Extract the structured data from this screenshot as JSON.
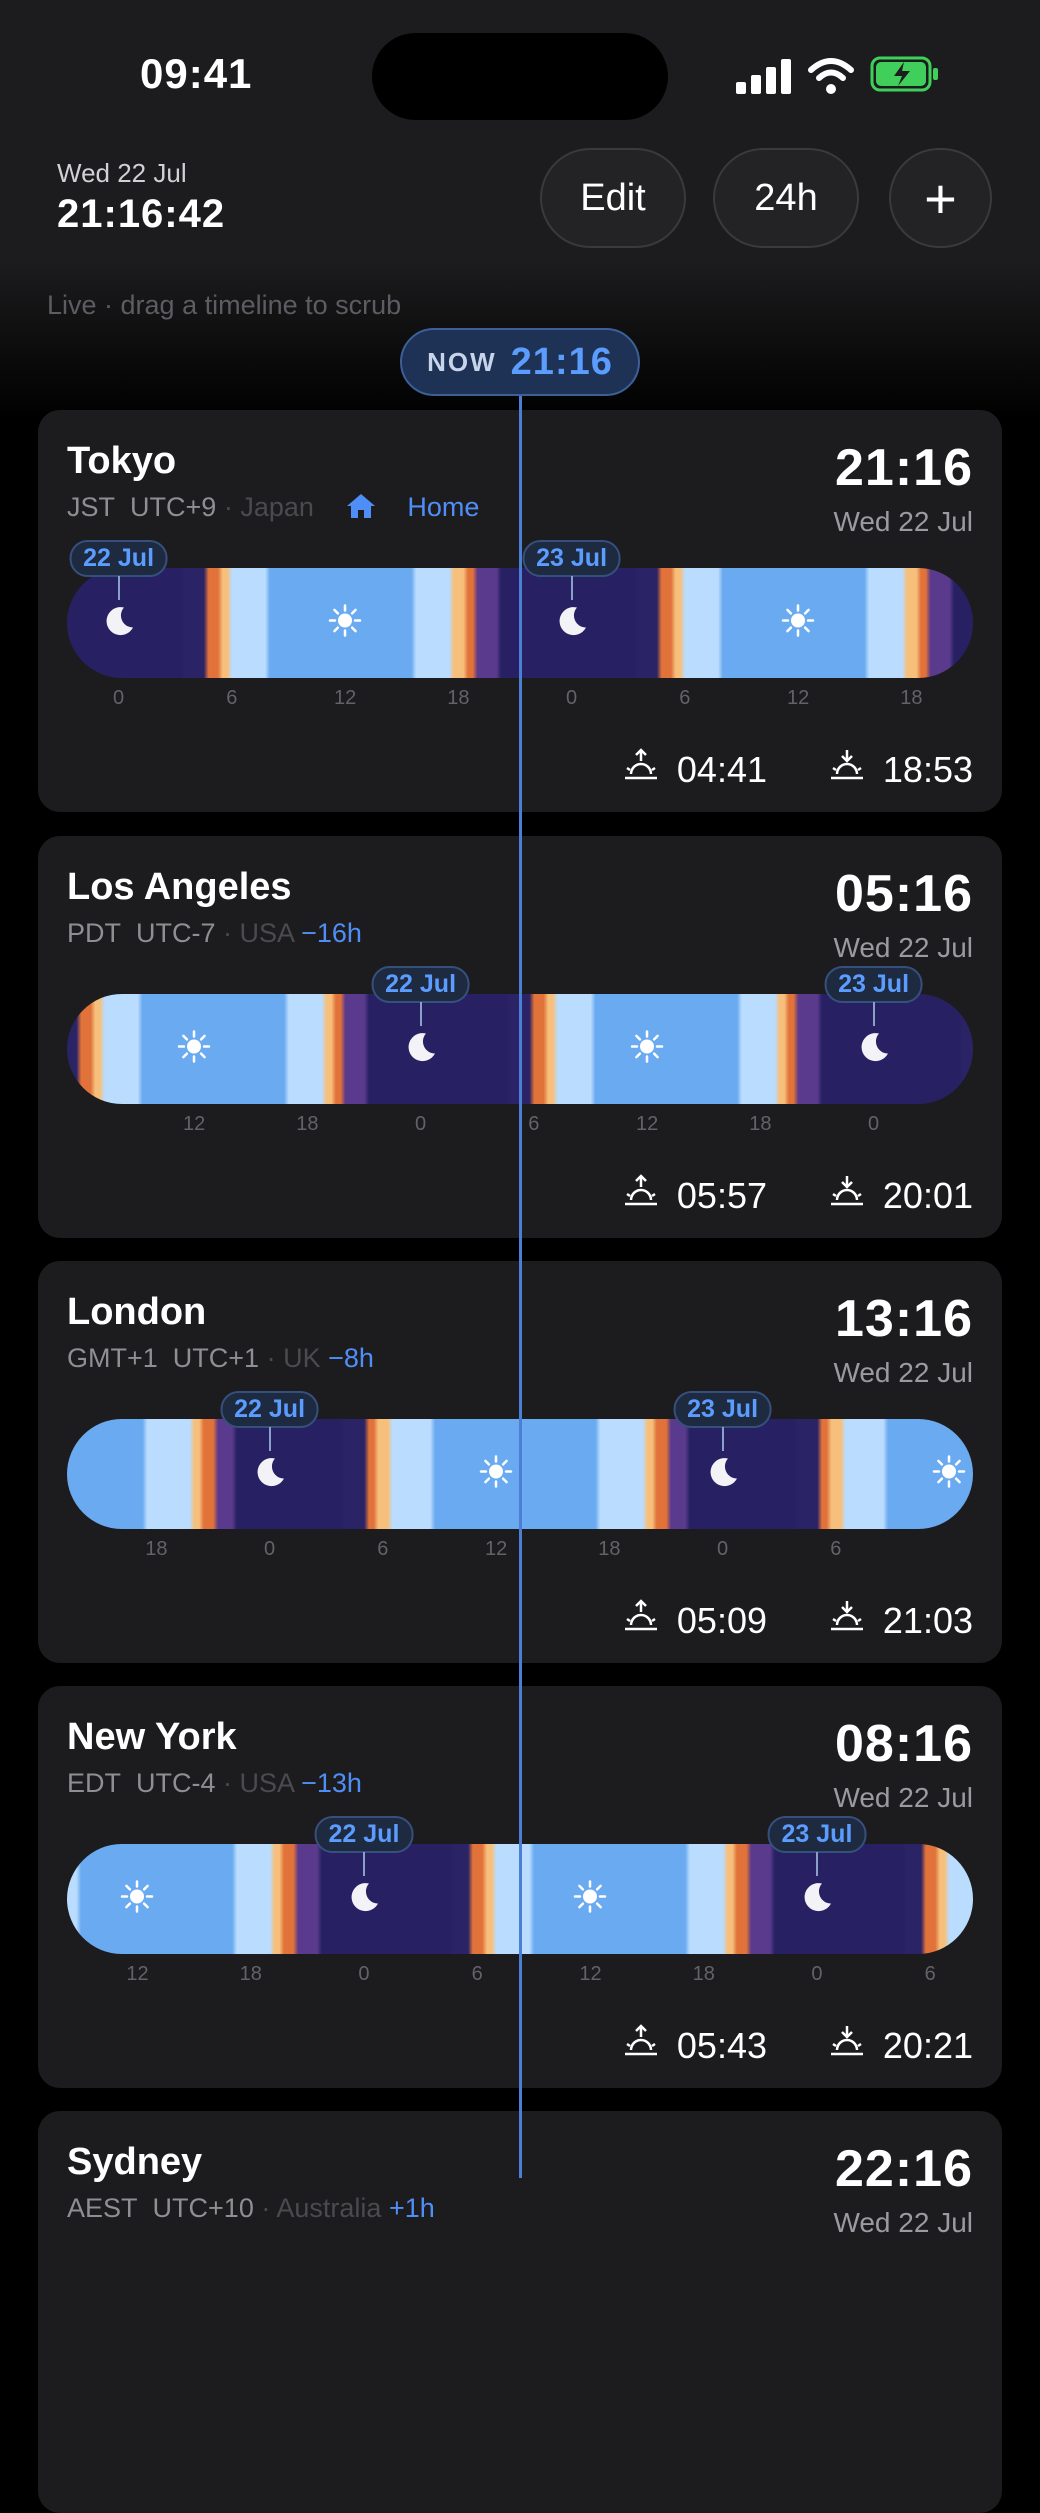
{
  "status_bar": {
    "time": "09:41"
  },
  "header": {
    "date": "Wed 22 Jul",
    "clock": "21:16:42",
    "edit_label": "Edit",
    "format_label": "24h",
    "add_label": "+"
  },
  "hint": "Live · drag a timeline to scrub",
  "now": {
    "label": "NOW",
    "time": "21:16"
  },
  "cities": [
    {
      "name": "Tokyo",
      "abbr": "JST",
      "utc": "UTC+9",
      "country": "Japan",
      "offset": "",
      "is_home": true,
      "home_label": "Home",
      "time": "21:16",
      "date": "Wed 22 Jul",
      "sunrise": "04:41",
      "sunset": "18:53",
      "ticks": [
        "0",
        "6",
        "12",
        "18",
        "0",
        "6",
        "12",
        "18"
      ],
      "day_tags": [
        {
          "label": "22 Jul",
          "col": 0
        },
        {
          "label": "23 Jul",
          "col": 4
        }
      ]
    },
    {
      "name": "Los Angeles",
      "abbr": "PDT",
      "utc": "UTC-7",
      "country": "USA",
      "offset": "−16h",
      "is_home": false,
      "time": "05:16",
      "date": "Wed 22 Jul",
      "sunrise": "05:57",
      "sunset": "20:01",
      "ticks": [
        "12",
        "18",
        "0",
        "6",
        "12",
        "18",
        "0"
      ],
      "day_tags": [
        {
          "label": "22 Jul",
          "col": 2
        },
        {
          "label": "23 Jul",
          "col": 6
        }
      ]
    },
    {
      "name": "London",
      "abbr": "GMT+1",
      "utc": "UTC+1",
      "country": "UK",
      "offset": "−8h",
      "is_home": false,
      "time": "13:16",
      "date": "Wed 22 Jul",
      "sunrise": "05:09",
      "sunset": "21:03",
      "ticks": [
        "18",
        "0",
        "6",
        "12",
        "18",
        "0",
        "6"
      ],
      "day_tags": [
        {
          "label": "22 Jul",
          "col": 1
        },
        {
          "label": "23 Jul",
          "col": 5
        }
      ]
    },
    {
      "name": "New York",
      "abbr": "EDT",
      "utc": "UTC-4",
      "country": "USA",
      "offset": "−13h",
      "is_home": false,
      "time": "08:16",
      "date": "Wed 22 Jul",
      "sunrise": "05:43",
      "sunset": "20:21",
      "ticks": [
        "12",
        "18",
        "0",
        "6",
        "12",
        "18",
        "0",
        "6"
      ],
      "day_tags": [
        {
          "label": "22 Jul",
          "col": 2
        },
        {
          "label": "23 Jul",
          "col": 6
        }
      ]
    },
    {
      "name": "Sydney",
      "abbr": "AEST",
      "utc": "UTC+10",
      "country": "Australia",
      "offset": "+1h",
      "is_home": false,
      "time": "22:16",
      "date": "Wed 22 Jul"
    }
  ]
}
